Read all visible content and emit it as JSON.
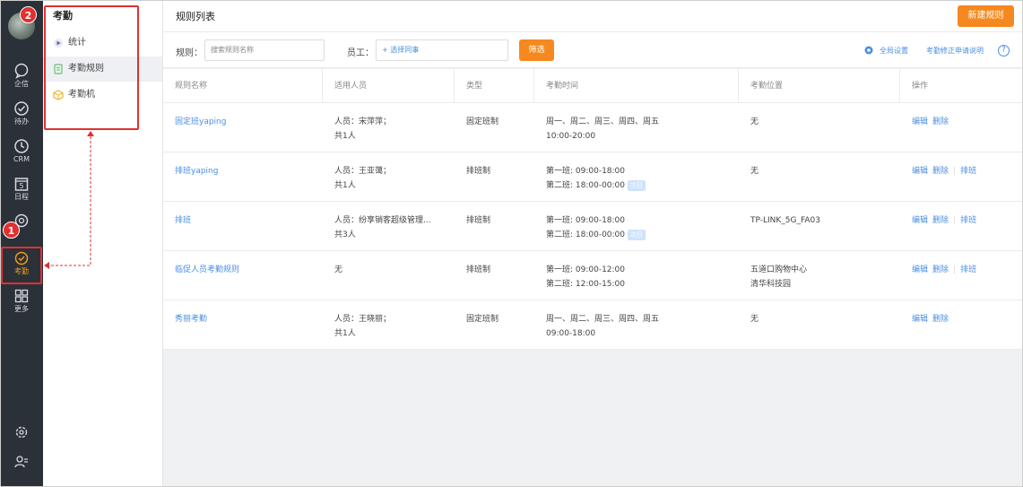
{
  "rail": {
    "items": [
      {
        "label": "企信",
        "icon": "chat-bubble-icon"
      },
      {
        "label": "待办",
        "icon": "check-circle-icon"
      },
      {
        "label": "CRM",
        "icon": "clock-icon"
      },
      {
        "label": "日程",
        "icon": "calendar-icon"
      },
      {
        "label": "",
        "icon": "target-icon"
      },
      {
        "label": "考勤",
        "icon": "attendance-icon"
      },
      {
        "label": "更多",
        "icon": "grid-icon"
      }
    ],
    "calendar_day": "5"
  },
  "submenu": {
    "title": "考勤",
    "items": [
      {
        "label": "统计"
      },
      {
        "label": "考勤规则"
      },
      {
        "label": "考勤机"
      }
    ]
  },
  "header": {
    "title": "规则列表",
    "new_button": "新建规则"
  },
  "filter": {
    "rule_label": "规则：",
    "rule_placeholder": "搜索规则名称",
    "employee_label": "员工：",
    "employee_placeholder": "+ 选择同事",
    "filter_button": "筛选",
    "global_settings": "全局设置",
    "correction_help": "考勤修正申请说明",
    "help_icon": "?"
  },
  "table": {
    "columns": [
      "规则名称",
      "适用人员",
      "类型",
      "考勤时间",
      "考勤位置",
      "操作"
    ],
    "rows": [
      {
        "name": "固定班yaping",
        "people1": "人员：宋萍萍；",
        "people2": "共1人",
        "type": "固定班制",
        "time1": "周一、周二、周三、周四、周五",
        "time2": "10:00-20:00",
        "tag": "",
        "loc1": "无",
        "loc2": "",
        "ops": [
          "编辑",
          "删除"
        ]
      },
      {
        "name": "排班yaping",
        "people1": "人员：王亚蔼；",
        "people2": "共1人",
        "type": "排班制",
        "time1": "第一班: 09:00-18:00",
        "time2": "第二班: 18:00-00:00",
        "tag": "次日",
        "loc1": "无",
        "loc2": "",
        "ops": [
          "编辑",
          "删除",
          "排班"
        ]
      },
      {
        "name": "排班",
        "people1": "人员：纷享销客超级管理...",
        "people2": "共3人",
        "type": "排班制",
        "time1": "第一班: 09:00-18:00",
        "time2": "第二班: 18:00-00:00",
        "tag": "次日",
        "loc1": "TP-LINK_5G_FA03",
        "loc2": "",
        "ops": [
          "编辑",
          "删除",
          "排班"
        ]
      },
      {
        "name": "临促人员考勤规则",
        "people1": "无",
        "people2": "",
        "type": "排班制",
        "time1": "第一班: 09:00-12:00",
        "time2": "第二班: 12:00-15:00",
        "tag": "",
        "loc1": "五道口购物中心",
        "loc2": "清华科技园",
        "ops": [
          "编辑",
          "删除",
          "排班"
        ]
      },
      {
        "name": "秀丽考勤",
        "people1": "人员：王晓丽；",
        "people2": "共1人",
        "type": "固定班制",
        "time1": "周一、周二、周三、周四、周五",
        "time2": "09:00-18:00",
        "tag": "",
        "loc1": "无",
        "loc2": "",
        "ops": [
          "编辑",
          "删除"
        ]
      }
    ]
  },
  "annotations": {
    "badge1": "1",
    "badge2": "2"
  },
  "colors": {
    "accent": "#f5891f",
    "link": "#4a8fe2",
    "rail_bg": "#2b3139",
    "highlight": "#e03030"
  }
}
